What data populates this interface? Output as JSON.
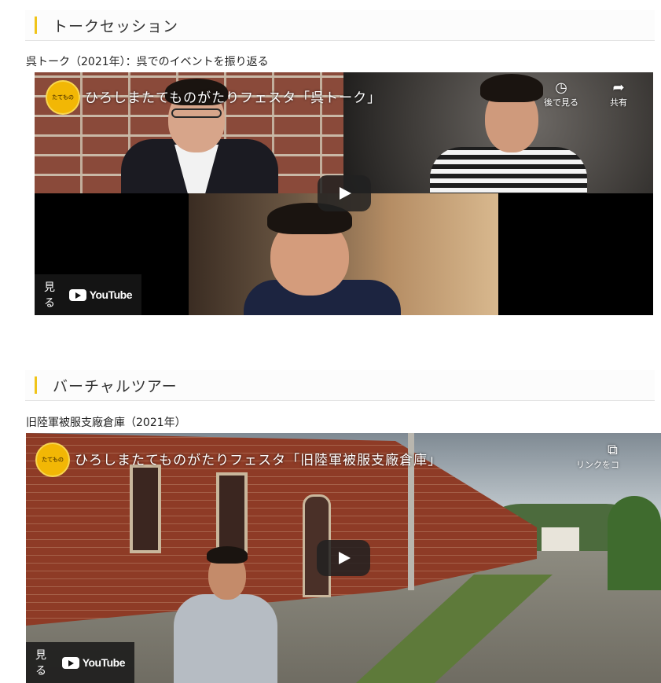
{
  "section1": {
    "heading": "トークセッション",
    "caption": "呉トーク（2021年）：呉でのイベントを振り返る",
    "video": {
      "title": "ひろしまたてものがたりフェスタ「呉トーク」",
      "watch_later_label": "後で見る",
      "share_label": "共有",
      "watch_label": "見る",
      "youtube_label": "YouTube"
    }
  },
  "section2": {
    "heading": "バーチャルツアー",
    "caption": "旧陸軍被服支廠倉庫（2021年）",
    "video": {
      "title": "ひろしまたてものがたりフェスタ「旧陸軍被服支廠倉庫」",
      "copy_link_label": "リンクをコ",
      "watch_label": "見る",
      "youtube_label": "YouTube"
    }
  },
  "colors": {
    "accent": "#f0c419",
    "player_overlay": "#171717"
  },
  "icons": {
    "watch_later": "clock-icon",
    "share": "share-arrow-icon",
    "copy_link": "copy-icon",
    "play": "play-icon"
  }
}
